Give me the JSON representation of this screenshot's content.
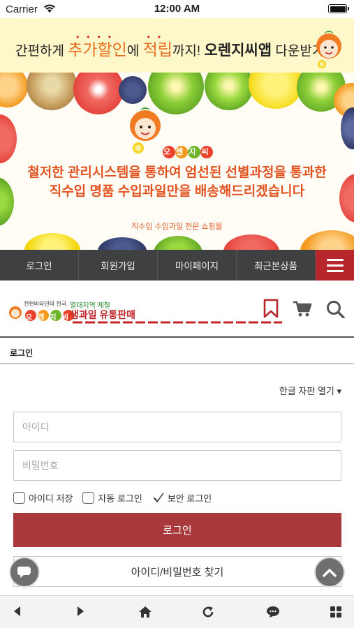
{
  "status": {
    "carrier": "Carrier",
    "time": "12:00 AM"
  },
  "promo": {
    "pre": "간편하게 ",
    "hl1": "추가할인",
    "mid": "에 ",
    "hl2": "적립",
    "post": "까지! ",
    "bold": "오렌지씨앱",
    "tail": " 다운받기!"
  },
  "hero": {
    "logo_text": "오렌지씨",
    "headline_1": "철저한 관리시스템을 통하여 엄선된 선별과정을 통과한",
    "headline_2": "직수입 명품 수입과일만을 배송해드리겠습니다",
    "sub": "직수입 수입과일 전문 쇼핑몰"
  },
  "nav": {
    "items": [
      "로그인",
      "회원가입",
      "마이페이지",
      "최근본상품"
    ],
    "menu_icon": "hamburger-menu-icon"
  },
  "brand": {
    "tag_small": "전편비타민의 천국",
    "logo_text": "오렌지씨",
    "tag_green": "열대지역 제철",
    "tag_red": "생과일 유통판매",
    "icons": [
      "bookmark-icon",
      "cart-icon",
      "search-icon"
    ],
    "accent": "#b6262b"
  },
  "page": {
    "breadcrumb": "로그인",
    "keyboard_toggle": "한글 자판 열기 ▾"
  },
  "form": {
    "id_placeholder": "아이디",
    "pw_placeholder": "비밀번호",
    "save_id": "아이디 저장",
    "auto_login": "자동 로그인",
    "secure_login": "보안 로그인",
    "login_button": "로그인",
    "find_button": "아이디/비밀번호 찾기",
    "button_color": "#a8383b"
  },
  "bottom_bar": {
    "icons": [
      "back-icon",
      "forward-icon",
      "home-icon",
      "refresh-icon",
      "chat-icon",
      "grid-icon"
    ]
  }
}
